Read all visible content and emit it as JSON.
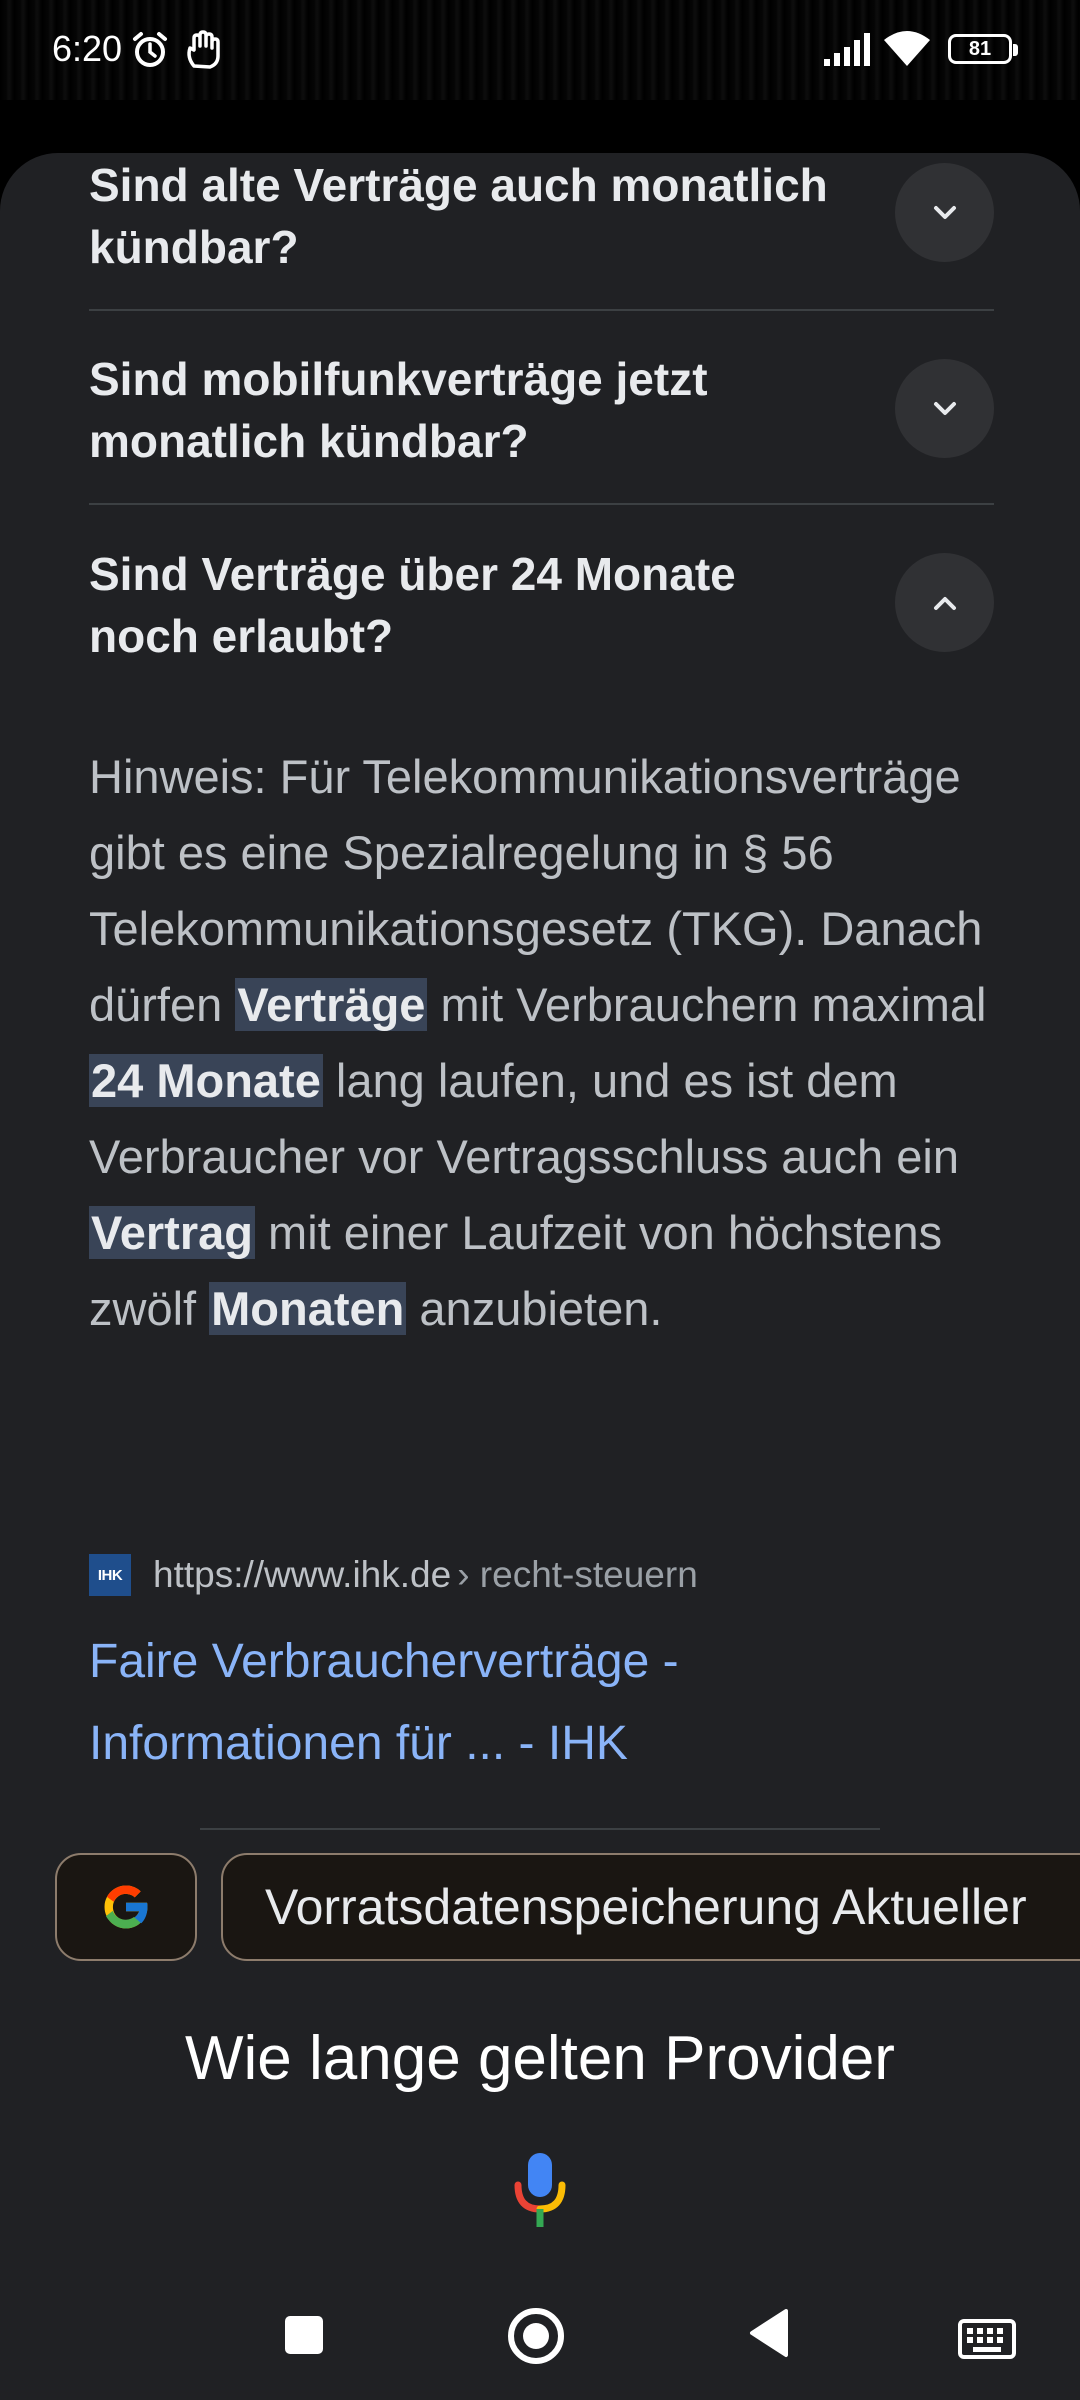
{
  "status_bar": {
    "time": "6:20",
    "battery": "81"
  },
  "faq": [
    {
      "question": "Sind alte Verträge auch monatlich kündbar?",
      "expanded": false
    },
    {
      "question": "Sind mobilfunkverträge jetzt monatlich kündbar?",
      "expanded": false
    },
    {
      "question": "Sind Verträge über 24 Monate noch erlaubt?",
      "expanded": true
    }
  ],
  "answer": {
    "p1": "Hinweis: Für Telekommunikationsverträge gibt es eine Spezialregelung in § 56 Telekommunikationsgesetz (TKG). Danach dürfen ",
    "h1": "Verträge",
    "p2": " mit Verbrauchern maximal ",
    "h2": "24 Monate",
    "p3": " lang laufen, und es ist dem Verbraucher vor Vertragsschluss auch ein ",
    "h3": "Vertrag",
    "p4": " mit einer Laufzeit von höchstens zwölf ",
    "h4": "Monaten",
    "p5": " anzubieten."
  },
  "source": {
    "logo_text": "IHK",
    "url": "https://www.ihk.de",
    "path": "› recht-steuern",
    "title": "Faire Verbraucherverträge - Informationen für ... - IHK"
  },
  "suggestion": "Vorratsdatenspeicherung Aktueller",
  "query": "Wie lange gelten Provider",
  "colors": {
    "link": "#8ab4f8",
    "highlight": "#394457",
    "sheet": "#202124"
  },
  "icons": [
    "alarm-icon",
    "hand-icon",
    "signal-icon",
    "wifi-icon",
    "battery-icon",
    "chevron-down-icon",
    "chevron-up-icon",
    "google-g-icon",
    "mic-icon",
    "keyboard-icon",
    "recents-icon",
    "home-icon",
    "back-icon"
  ]
}
